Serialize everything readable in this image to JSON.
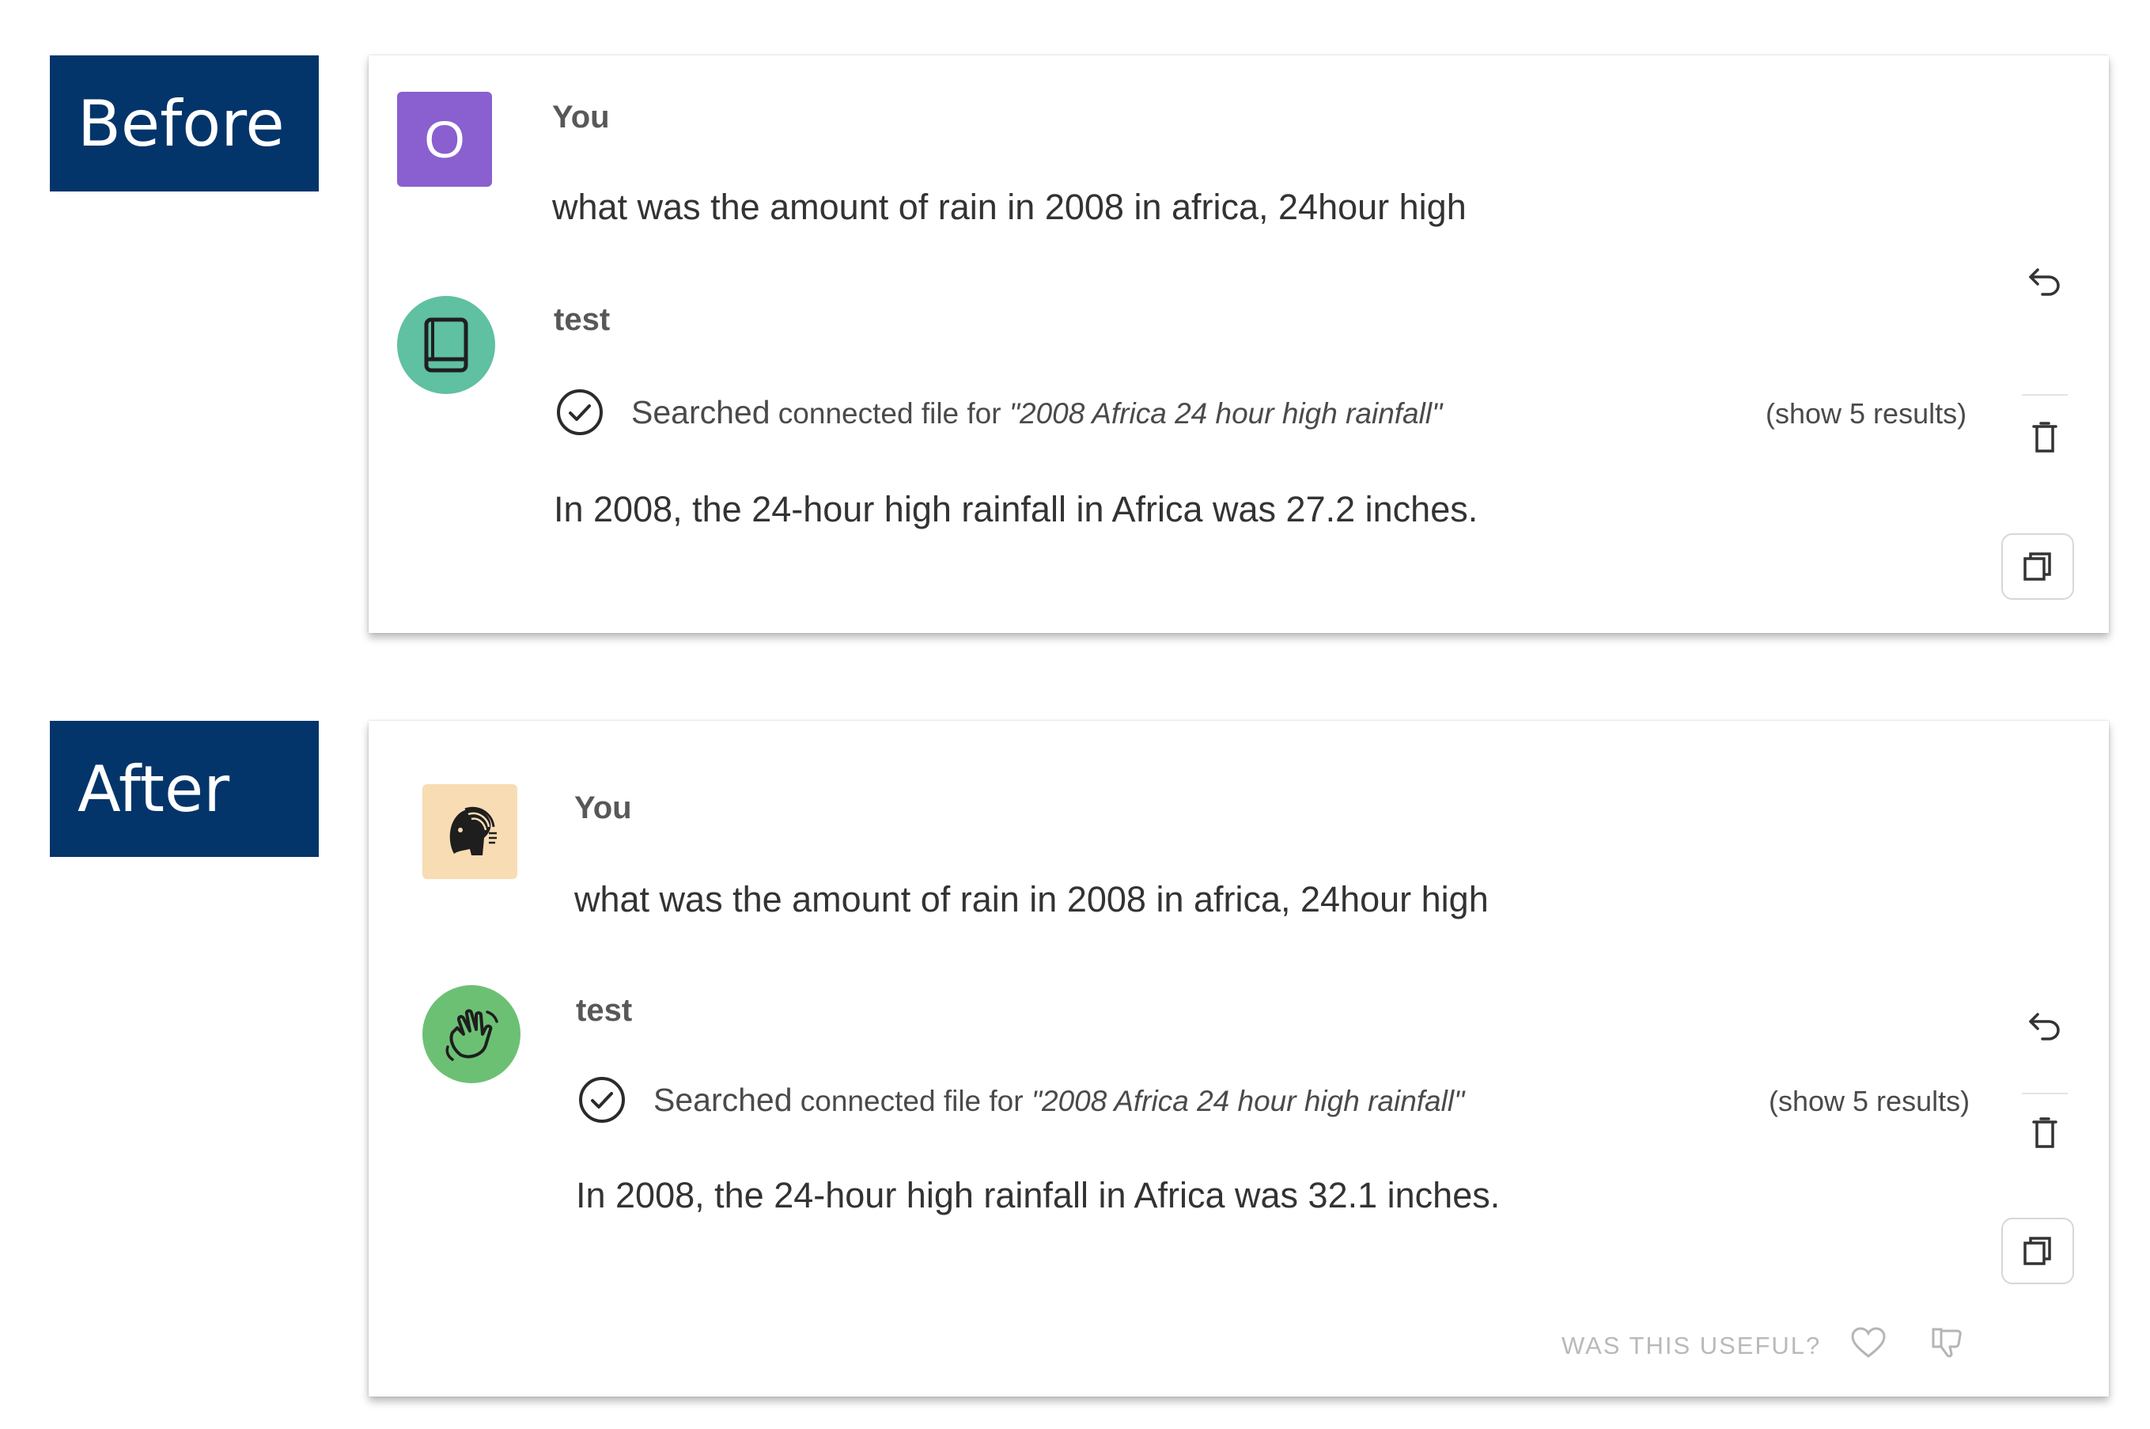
{
  "labels": {
    "before": "Before",
    "after": "After"
  },
  "before": {
    "user_name": "You",
    "user_initial": "O",
    "user_message": "what was the amount of rain in 2008 in africa, 24hour high",
    "bot_name": "test",
    "search_prefix": "Searched",
    "search_middle": " connected file for ",
    "search_query": "\"2008 Africa 24 hour high rainfall\"",
    "show_results": "(show 5 results)",
    "bot_response": "In 2008, the 24-hour high rainfall in Africa was 27.2 inches."
  },
  "after": {
    "user_name": "You",
    "user_message": "what was the amount of rain in 2008 in africa, 24hour high",
    "bot_name": "test",
    "search_prefix": "Searched",
    "search_middle": " connected file for ",
    "search_query": "\"2008 Africa 24 hour high rainfall\"",
    "show_results": "(show 5 results)",
    "bot_response": "In 2008, the 24-hour high rainfall in Africa was 32.1 inches.",
    "feedback_prompt": "WAS THIS USEFUL?"
  },
  "icons": {
    "regenerate": "undo-arrow-icon",
    "delete": "trash-icon",
    "copy": "copy-icon",
    "check": "check-circle-icon",
    "like": "heart-icon",
    "dislike": "thumbs-down-icon"
  },
  "colors": {
    "label_bg": "#03356a",
    "user_avatar_before": "#8a5fcf",
    "bot_avatar_before": "#5fc0a2",
    "user_avatar_after": "#f8dcb4",
    "bot_avatar_after": "#6cc073"
  }
}
